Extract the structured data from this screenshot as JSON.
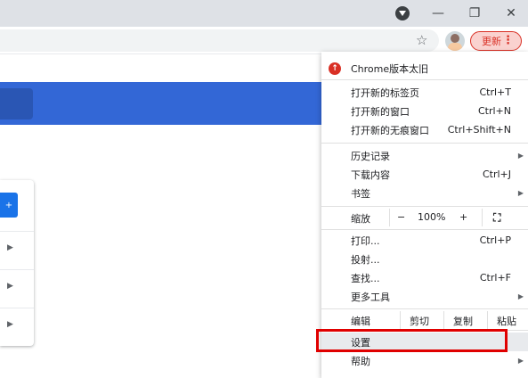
{
  "window": {
    "minimize_icon": "minimize-icon",
    "restore_icon": "restore-icon",
    "close_icon": "close-icon"
  },
  "toolbar": {
    "update_label": "更新",
    "more_glyph": "⋮",
    "star_glyph": "☆"
  },
  "page": {
    "card_button_glyph": "+"
  },
  "menu": {
    "update_notice": "Chrome版本太旧",
    "group1": [
      {
        "label": "打开新的标签页",
        "shortcut": "Ctrl+T"
      },
      {
        "label": "打开新的窗口",
        "shortcut": "Ctrl+N"
      },
      {
        "label": "打开新的无痕窗口",
        "shortcut": "Ctrl+Shift+N"
      }
    ],
    "group2": [
      {
        "label": "历史记录"
      },
      {
        "label": "下载内容",
        "shortcut": "Ctrl+J"
      },
      {
        "label": "书签"
      }
    ],
    "zoom": {
      "label": "缩放",
      "minus": "−",
      "value": "100%",
      "plus": "+",
      "fullscreen": "⛶"
    },
    "group3": [
      {
        "label": "打印...",
        "shortcut": "Ctrl+P"
      },
      {
        "label": "投射..."
      },
      {
        "label": "查找...",
        "shortcut": "Ctrl+F"
      },
      {
        "label": "更多工具"
      }
    ],
    "edit": {
      "label": "编辑",
      "cut": "剪切",
      "copy": "复制",
      "paste": "粘贴"
    },
    "settings": "设置",
    "help": "帮助"
  },
  "colors": {
    "accent_blue": "#3367d6",
    "update_red": "#d93025",
    "highlight_red": "#e00000"
  }
}
